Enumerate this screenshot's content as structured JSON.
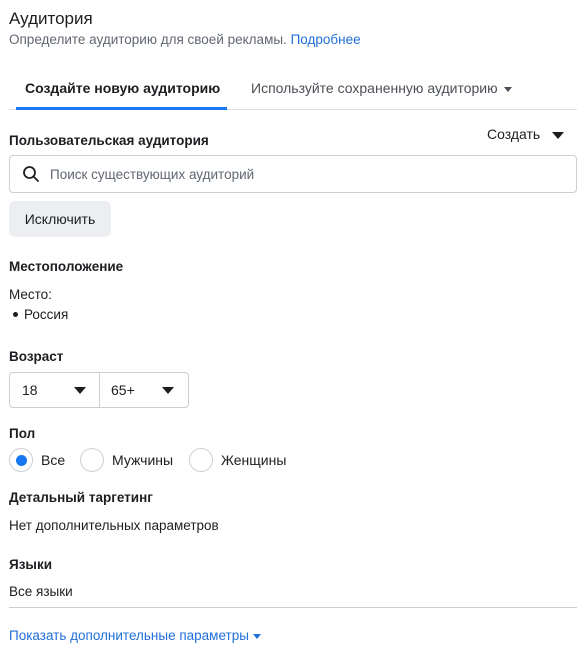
{
  "header": {
    "title": "Аудитория",
    "subtitle": "Определите аудиторию для своей рекламы.",
    "learn_more": "Подробнее"
  },
  "tabs": {
    "new_audience": "Создайте новую аудиторию",
    "saved_audience": "Используйте сохраненную аудиторию"
  },
  "custom_audience": {
    "label": "Пользовательская аудитория",
    "create_label": "Создать",
    "search_placeholder": "Поиск существующих аудиторий",
    "search_value": "",
    "exclude_label": "Исключить"
  },
  "location": {
    "label": "Местоположение",
    "place_label": "Место:",
    "places": [
      "Россия"
    ]
  },
  "age": {
    "label": "Возраст",
    "min": "18",
    "max": "65+"
  },
  "gender": {
    "label": "Пол",
    "options": [
      "Все",
      "Мужчины",
      "Женщины"
    ],
    "selected": "Все"
  },
  "detailed_targeting": {
    "label": "Детальный таргетинг",
    "value": "Нет дополнительных параметров"
  },
  "languages": {
    "label": "Языки",
    "value": "Все языки"
  },
  "footer": {
    "more_options": "Показать дополнительные параметры"
  },
  "colors": {
    "accent": "#1877f2",
    "link": "#216fdb",
    "border": "#ccd0d5",
    "button_bg": "#eceef1"
  }
}
